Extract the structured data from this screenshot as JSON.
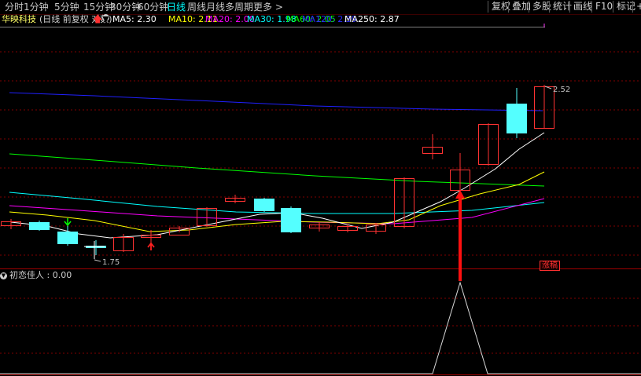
{
  "periods": [
    {
      "label": "分时",
      "active": false
    },
    {
      "label": "1分钟",
      "active": false
    },
    {
      "label": "5分钟",
      "active": false
    },
    {
      "label": "15分钟",
      "active": false
    },
    {
      "label": "30分钟",
      "active": false
    },
    {
      "label": "60分钟",
      "active": false
    },
    {
      "label": "日线",
      "active": true
    },
    {
      "label": "周线",
      "active": false
    },
    {
      "label": "月线",
      "active": false
    },
    {
      "label": "多周期",
      "active": false
    },
    {
      "label": "更多 >",
      "active": false
    }
  ],
  "toolbar": [
    "复权",
    "叠加",
    "多股",
    "统计",
    "画线",
    "F10",
    "标记",
    "+自"
  ],
  "stock": {
    "name": "华映科技",
    "mode": "(日线 前复权 对数)",
    "ma5": "MA5: 2.30",
    "ma10": "MA10: 2.11",
    "ma20": "MA20: 2.00",
    "ma30": "MA30: 1.98",
    "ma60": "MA60: 2.05",
    "ma120": "MA120: 2.39",
    "ma250": "MA250: 2.87"
  },
  "colors": {
    "up": "#ff3232",
    "down": "#54ffff",
    "ma5": "#ffffff",
    "ma10": "#ffff00",
    "ma20": "#ff00ff",
    "ma30": "#00ffff",
    "ma60": "#00ff00",
    "ma120": "#2020ff",
    "ma250": "#ffffff",
    "grid": "#800000"
  },
  "price_labels": {
    "high": "2.52",
    "low": "1.75"
  },
  "indicator": {
    "name": "初恋佳人",
    "value": "0.00",
    "signal_label": "涨稿"
  }
}
